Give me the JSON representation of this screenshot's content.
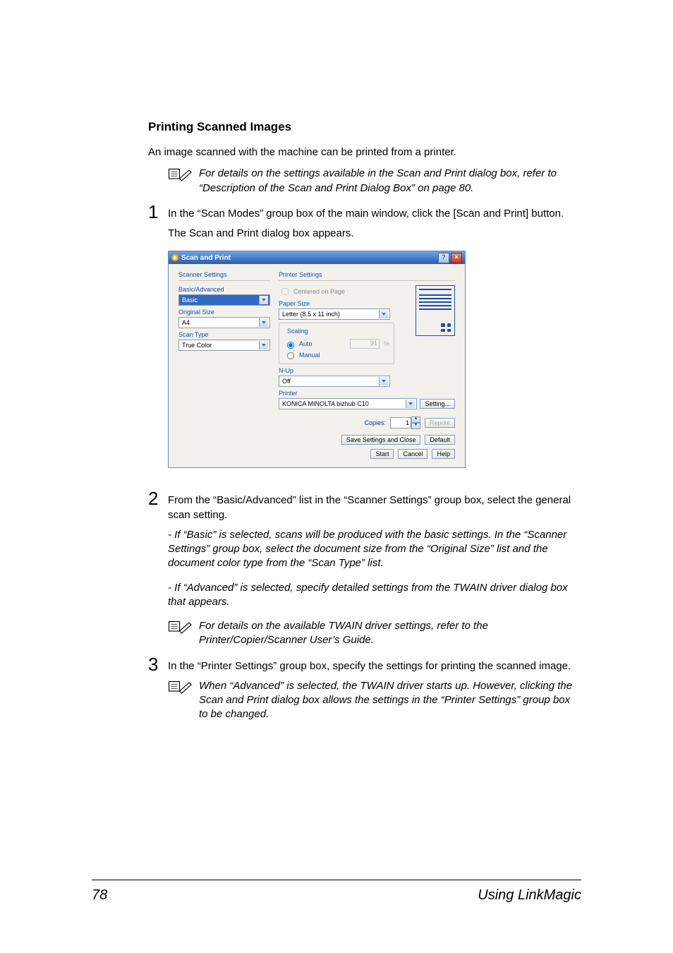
{
  "heading": "Printing Scanned Images",
  "intro": "An image scanned with the machine can be printed from a printer.",
  "note1": "For details on the settings available in the Scan and Print dialog box, refer to “Description of the Scan and Print Dialog Box” on page 80.",
  "step1_num": "1",
  "step1_body": "In the “Scan Modes” group box of the main window, click the [Scan and Print] button.",
  "step1_sub": "The Scan and Print dialog box appears.",
  "dialog": {
    "title": "Scan and Print",
    "help_btn": "?",
    "close_btn": "×",
    "scanner_settings": {
      "group": "Scanner Settings",
      "basic_adv_label": "Basic/Advanced",
      "basic_adv_value": "Basic",
      "orig_size_label": "Original Size",
      "orig_size_value": "A4",
      "scan_type_label": "Scan Type",
      "scan_type_value": "True Color"
    },
    "printer_settings": {
      "group": "Printer Settings",
      "centered_label": "Centered on Page",
      "paper_size_label": "Paper Size",
      "paper_size_value": "Letter (8.5 x 11 inch)",
      "scaling_legend": "Scaling",
      "auto_label": "Auto",
      "manual_label": "Manual",
      "percent_value": "91",
      "percent_suffix": "%",
      "nup_label": "N-Up",
      "nup_value": "Off",
      "printer_label": "Printer",
      "printer_value": "KONICA MINOLTA bizhub C10",
      "setting_btn": "Setting...",
      "copies_label": "Copies:",
      "copies_value": "1",
      "reprint_btn": "Reprint"
    },
    "buttons": {
      "save_close": "Save Settings and Close",
      "default": "Default",
      "start": "Start",
      "cancel": "Cancel",
      "help": "Help"
    }
  },
  "step2_num": "2",
  "step2_body": "From the “Basic/Advanced” list in the “Scanner Settings” group box, select the general scan setting.",
  "step2_sub_a": "- If “Basic” is selected, scans will be produced with the basic settings. In the “Scanner Settings” group box, select the document size from the “Original Size” list and the document color type from the “Scan Type” list.",
  "step2_sub_b": "- If “Advanced” is selected, specify detailed settings from the TWAIN driver dialog box that appears.",
  "note2": "For details on the available TWAIN driver settings, refer to the Printer/Copier/Scanner User’s Guide.",
  "step3_num": "3",
  "step3_body": "In the “Printer Settings” group box, specify the settings for printing the scanned image.",
  "note3": "When “Advanced” is selected, the TWAIN driver starts up. However, clicking the Scan and Print dialog box allows the settings in the “Printer Settings” group box to be changed.",
  "footer": {
    "page": "78",
    "section": "Using LinkMagic"
  }
}
